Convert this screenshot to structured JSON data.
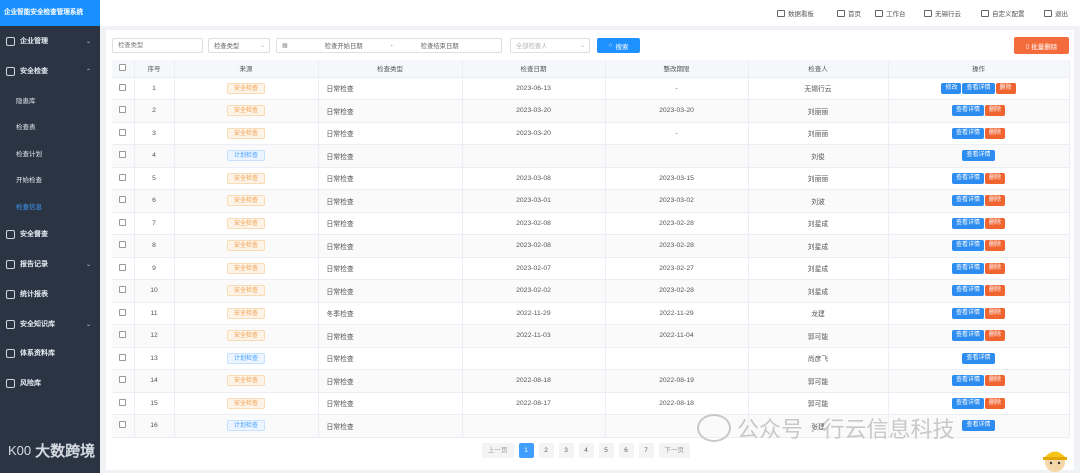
{
  "brand": "企业智能安全检查管理系统",
  "sidebar": {
    "items": [
      {
        "label": "企业管理",
        "icon": "building-icon",
        "chevron": "⌄"
      },
      {
        "label": "安全检查",
        "icon": "inspect-icon",
        "chevron": "⌃"
      },
      {
        "label": "安全督查",
        "icon": "bolt-icon",
        "chevron": ""
      },
      {
        "label": "报告记录",
        "icon": "report-icon",
        "chevron": "⌄"
      },
      {
        "label": "统计报表",
        "icon": "folder-icon",
        "chevron": ""
      },
      {
        "label": "安全知识库",
        "icon": "book-icon",
        "chevron": "⌄"
      },
      {
        "label": "体系资料库",
        "icon": "gear-icon",
        "chevron": ""
      },
      {
        "label": "风险库",
        "icon": "risk-icon",
        "chevron": ""
      }
    ],
    "sub_items": [
      "隐患库",
      "检查表",
      "检查计划",
      "开始检查",
      "检查信息"
    ],
    "watermark": "大数跨境",
    "watermark_logo": "K00"
  },
  "topbar": {
    "links": [
      "数据看板",
      "首页",
      "工作台",
      "无锡行云",
      "自定义配置",
      "退出"
    ]
  },
  "filters": {
    "type_input_placeholder": "检查类型",
    "type_select": "检查类型",
    "date_start_placeholder": "检查开始日期",
    "date_sep": "-",
    "date_end_placeholder": "检查结束日期",
    "inspector_placeholder": "全部检查人",
    "search_label": "搜索",
    "batch_delete_label": "批量删除"
  },
  "table": {
    "headers": [
      "序号",
      "来源",
      "检查类型",
      "检查日期",
      "整改期限",
      "检查人",
      "操作"
    ],
    "actions": {
      "edit": "修改",
      "view": "查看详情",
      "delete": "删除"
    },
    "rows": [
      {
        "no": "1",
        "source": "安全检查",
        "source_kind": "orange",
        "type": "日常检查",
        "date": "2023-06-13",
        "deadline": "-",
        "inspector": "无锡行云",
        "ops": [
          "edit",
          "view",
          "delete"
        ]
      },
      {
        "no": "2",
        "source": "安全检查",
        "source_kind": "orange",
        "type": "日常检查",
        "date": "2023-03-20",
        "deadline": "2023-03-20",
        "inspector": "刘丽丽",
        "ops": [
          "view",
          "delete"
        ]
      },
      {
        "no": "3",
        "source": "安全检查",
        "source_kind": "orange",
        "type": "日常检查",
        "date": "2023-03-20",
        "deadline": "-",
        "inspector": "刘丽丽",
        "ops": [
          "view",
          "delete"
        ]
      },
      {
        "no": "4",
        "source": "计划检查",
        "source_kind": "blue",
        "type": "日常检查",
        "date": "",
        "deadline": "",
        "inspector": "刘俊",
        "ops": [
          "view"
        ]
      },
      {
        "no": "5",
        "source": "安全检查",
        "source_kind": "orange",
        "type": "日常检查",
        "date": "2023-03-08",
        "deadline": "2023-03-15",
        "inspector": "刘丽丽",
        "ops": [
          "view",
          "delete"
        ]
      },
      {
        "no": "6",
        "source": "安全检查",
        "source_kind": "orange",
        "type": "日常检查",
        "date": "2023-03-01",
        "deadline": "2023-03-02",
        "inspector": "刘波",
        "ops": [
          "view",
          "delete"
        ]
      },
      {
        "no": "7",
        "source": "安全检查",
        "source_kind": "orange",
        "type": "日常检查",
        "date": "2023-02-08",
        "deadline": "2023-02-28",
        "inspector": "刘星成",
        "ops": [
          "view",
          "delete"
        ]
      },
      {
        "no": "8",
        "source": "安全检查",
        "source_kind": "orange",
        "type": "日常检查",
        "date": "2023-02-08",
        "deadline": "2023-02-28",
        "inspector": "刘星成",
        "ops": [
          "view",
          "delete"
        ]
      },
      {
        "no": "9",
        "source": "安全检查",
        "source_kind": "orange",
        "type": "日常检查",
        "date": "2023-02-07",
        "deadline": "2023-02-27",
        "inspector": "刘星成",
        "ops": [
          "view",
          "delete"
        ]
      },
      {
        "no": "10",
        "source": "安全检查",
        "source_kind": "orange",
        "type": "日常检查",
        "date": "2023-02-02",
        "deadline": "2023-02-28",
        "inspector": "刘星成",
        "ops": [
          "view",
          "delete"
        ]
      },
      {
        "no": "11",
        "source": "安全检查",
        "source_kind": "orange",
        "type": "冬季检查",
        "date": "2022-11-29",
        "deadline": "2022-11-29",
        "inspector": "龙建",
        "ops": [
          "view",
          "delete"
        ]
      },
      {
        "no": "12",
        "source": "安全检查",
        "source_kind": "orange",
        "type": "日常检查",
        "date": "2022-11-03",
        "deadline": "2022-11-04",
        "inspector": "郭可能",
        "ops": [
          "view",
          "delete"
        ]
      },
      {
        "no": "13",
        "source": "计划检查",
        "source_kind": "blue",
        "type": "日常检查",
        "date": "",
        "deadline": "",
        "inspector": "尚彦飞",
        "ops": [
          "view"
        ]
      },
      {
        "no": "14",
        "source": "安全检查",
        "source_kind": "orange",
        "type": "日常检查",
        "date": "2022-08-18",
        "deadline": "2022-08-19",
        "inspector": "郭可能",
        "ops": [
          "view",
          "delete"
        ]
      },
      {
        "no": "15",
        "source": "安全检查",
        "source_kind": "orange",
        "type": "日常检查",
        "date": "2022-08-17",
        "deadline": "2022-08-18",
        "inspector": "郭可能",
        "ops": [
          "view",
          "delete"
        ]
      },
      {
        "no": "16",
        "source": "计划检查",
        "source_kind": "blue",
        "type": "日常检查",
        "date": "",
        "deadline": "",
        "inspector": "张建",
        "ops": [
          "view"
        ]
      }
    ]
  },
  "pagination": {
    "prev": "上一页",
    "pages": [
      "1",
      "2",
      "3",
      "4",
      "5",
      "6",
      "7"
    ],
    "current": "1",
    "next": "下一页"
  },
  "wechat_watermark": "公众号 · 行云信息科技",
  "colors": {
    "primary": "#1890ff",
    "danger": "#f06430",
    "sidebar": "#2b3443"
  }
}
